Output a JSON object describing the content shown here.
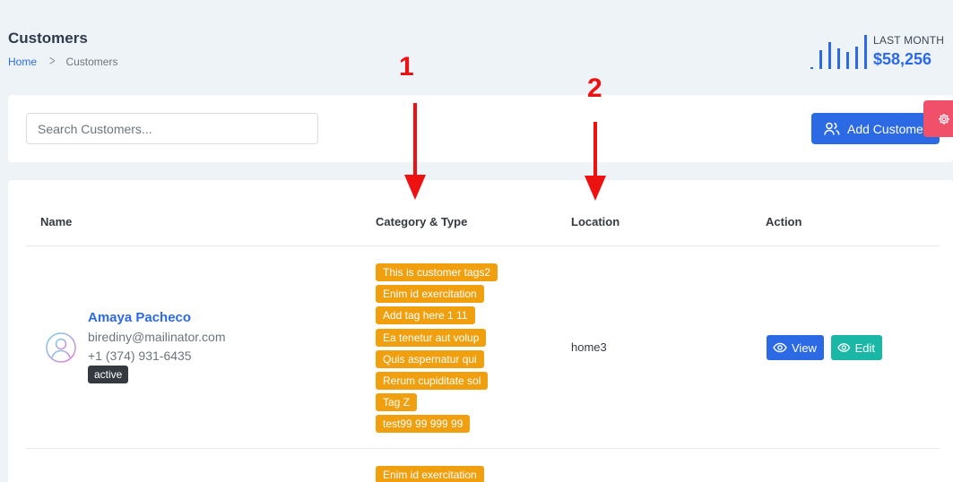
{
  "page": {
    "title": "Customers"
  },
  "breadcrumb": {
    "home": "Home",
    "separator": ">",
    "current": "Customers"
  },
  "stat": {
    "label": "LAST MONTH",
    "value": "$58,256",
    "bar_levels": [
      0.05,
      0.55,
      0.8,
      0.6,
      0.5,
      0.65,
      1.0
    ],
    "color": "#2c6ae5"
  },
  "toolbar": {
    "search_placeholder": "Search Customers...",
    "add_label": "Add Customer"
  },
  "table": {
    "headers": {
      "name": "Name",
      "category": "Category & Type",
      "location": "Location",
      "action": "Action"
    },
    "rows": [
      {
        "name": "Amaya Pacheco",
        "email": "birediny@mailinator.com",
        "phone": "+1 (374) 931-6435",
        "status": "active",
        "tags": [
          "This is customer tags2",
          "Enim id exercitation",
          "Add tag here 1 11",
          "Ea tenetur aut volup",
          "Quis aspernatur qui",
          "Rerum cupiditate sol",
          "Tag Z",
          "test99 99 999 99"
        ],
        "location": "home3",
        "view_label": "View",
        "edit_label": "Edit"
      },
      {
        "tags": [
          "Enim id exercitation"
        ]
      }
    ]
  },
  "annotations": {
    "one": "1",
    "two": "2"
  },
  "colors": {
    "primary": "#2c6ae5",
    "tag": "#f0a00f",
    "edit": "#1ab7a7",
    "settings": "#f1506b",
    "annotation": "#ee1111"
  }
}
